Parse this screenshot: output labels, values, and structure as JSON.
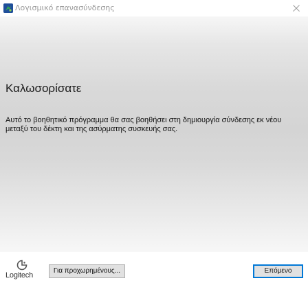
{
  "window": {
    "title": "Λογισμικό επανασύνδεσης",
    "app_icon": "logitech-unifying-icon",
    "close_icon": "close-icon"
  },
  "main": {
    "heading": "Καλωσορίσατε",
    "description": "Αυτό το βοηθητικό πρόγραμμα θα σας βοηθήσει στη δημιουργία σύνδεσης εκ νέου μεταξύ του δέκτη και της ασύρματης συσκευής σας."
  },
  "footer": {
    "logo_text": "Logitech",
    "logo_icon": "logitech-logo-icon",
    "advanced_button_label": "Για προχωρημένους...",
    "next_button_label": "Επόμενο"
  },
  "colors": {
    "accent": "#0078d7",
    "icon_bg": "#1f4e9a",
    "icon_mark": "#39b54a"
  }
}
